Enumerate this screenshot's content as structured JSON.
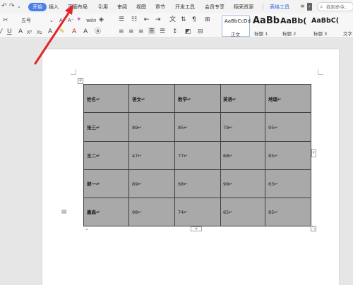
{
  "toolbar_top": {
    "undo_icon": "undo-icon",
    "redo_icon": "redo-icon",
    "dropdown_icon": "chevron-down-icon"
  },
  "tabs": [
    {
      "label": "开始",
      "active": true
    },
    {
      "label": "插入"
    },
    {
      "label": "页面布局"
    },
    {
      "label": "引用"
    },
    {
      "label": "审阅"
    },
    {
      "label": "视图"
    },
    {
      "label": "章节"
    },
    {
      "label": "开发工具"
    },
    {
      "label": "会员专享"
    },
    {
      "label": "稻壳资源"
    },
    {
      "label": "表格工具",
      "blue": true
    }
  ],
  "search": {
    "label": "找到命令、"
  },
  "ribbon": {
    "font_size": "五号",
    "styles": [
      {
        "preview": "AaBbCcDd",
        "name": "正文"
      },
      {
        "preview": "AaBb",
        "name": "标题 1"
      },
      {
        "preview": "AaBb(",
        "name": "标题 2"
      },
      {
        "preview": "AaBbC(",
        "name": "标题 3"
      },
      {
        "preview": "",
        "name": "文字"
      }
    ]
  },
  "table": {
    "rows": [
      [
        "姓名↵",
        "语文↵",
        "数学↵",
        "英语↵",
        "地理↵"
      ],
      [
        "张三↵",
        "89↵",
        "85↵",
        "79↵",
        "95↵"
      ],
      [
        "王二↵",
        "47↵",
        "77↵",
        "68↵",
        "85↵"
      ],
      [
        "郭一↵",
        "89↵",
        "68↵",
        "99↵",
        "63↵"
      ],
      [
        "嘉森↵",
        "98↵",
        "74↵",
        "65↵",
        "85↵"
      ]
    ]
  },
  "colors": {
    "accent": "#4a7ee8",
    "table_fill": "#a9a9a9",
    "arrow": "#e0262a"
  }
}
